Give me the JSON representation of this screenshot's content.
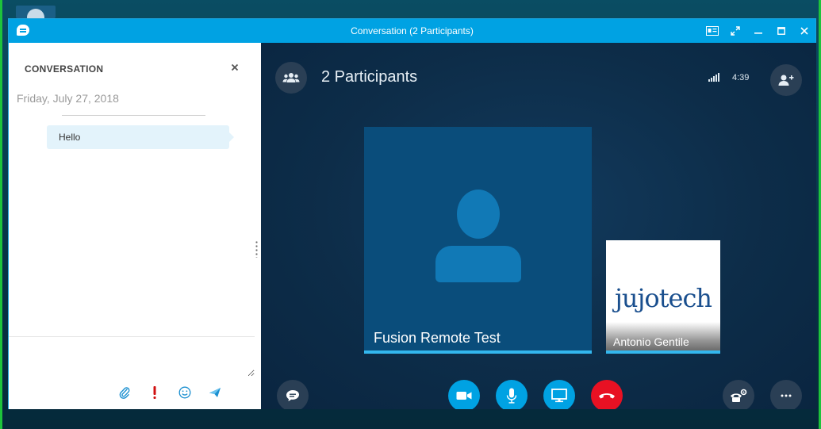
{
  "window": {
    "title": "Conversation (2 Participants)"
  },
  "left_pane": {
    "header": "CONVERSATION",
    "date": "Friday, July 27, 2018",
    "messages": [
      {
        "text": "Hello"
      }
    ],
    "compose_placeholder": ""
  },
  "stage": {
    "title": "2 Participants",
    "timer": "4:39",
    "participants": [
      {
        "name": "Fusion Remote Test"
      },
      {
        "name": "Antonio Gentile"
      }
    ],
    "brand": {
      "part1": "juj",
      "part2": "otech"
    }
  },
  "colors": {
    "titlebar": "#00a2e3",
    "accent": "#33b7ee",
    "hangup": "#e81123",
    "urgent": "#d01010"
  },
  "icons": {
    "title": "chat-bubble-icon",
    "participants": "people-icon",
    "add_person": "add-person-icon",
    "im": "chat-bubble-icon",
    "video": "video-camera-icon",
    "mic": "microphone-icon",
    "share": "monitor-icon",
    "hangup": "hangup-phone-icon",
    "call_controls": "phone-gear-icon",
    "more": "ellipsis-icon",
    "attach": "paperclip-icon",
    "urgent": "exclamation-icon",
    "emoji": "smiley-icon",
    "send": "send-icon"
  }
}
